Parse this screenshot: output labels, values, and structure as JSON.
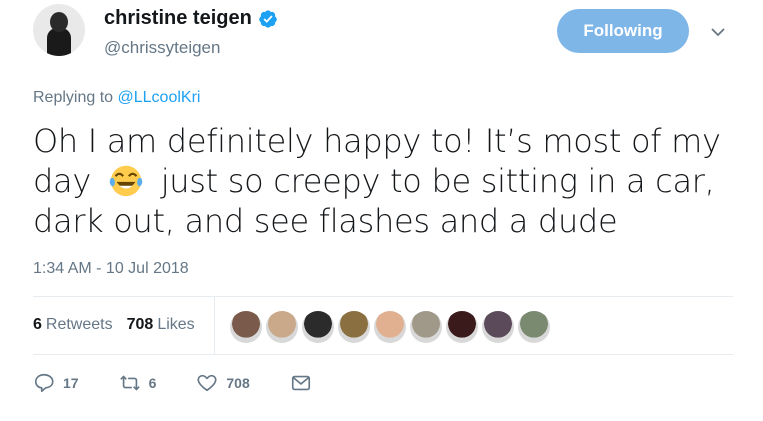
{
  "author": {
    "display_name": "christine teigen",
    "handle": "@chrissyteigen",
    "verified": true,
    "avatar_icon": "profile-photo"
  },
  "follow_button": {
    "label": "Following",
    "color": "#7fb6e8"
  },
  "reply_context": {
    "prefix": "Replying to ",
    "mention": "@LLcoolKri"
  },
  "tweet": {
    "text_part1": "Oh I am definitely happy to! It’s most of my day",
    "emoji": "face-with-tears-of-joy",
    "text_part2": "just so creepy to be sitting in a car, dark out, and see flashes and a dude",
    "timestamp": "1:34 AM - 10 Jul 2018"
  },
  "stats": {
    "retweets_count": "6",
    "retweets_label": "Retweets",
    "likes_count": "708",
    "likes_label": "Likes",
    "liker_avatar_colors": [
      "#7a5a4a",
      "#c9a98a",
      "#2b2b2b",
      "#8a7040",
      "#e0b090",
      "#a09888",
      "#3a1a1a",
      "#5a4a5a",
      "#7a8a70"
    ]
  },
  "actions": {
    "reply_count": "17",
    "retweet_count": "6",
    "like_count": "708"
  },
  "colors": {
    "link": "#1da1f2",
    "secondary": "#657786",
    "text": "#14171a"
  }
}
